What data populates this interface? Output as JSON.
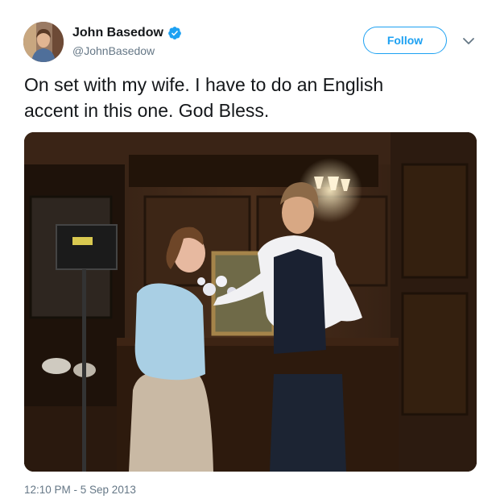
{
  "colors": {
    "brand_blue": "#1da1f2",
    "secondary_text": "#657786",
    "primary_text": "#14171a"
  },
  "author": {
    "display_name": "John Basedow",
    "handle": "@JohnBasedow",
    "verified": true,
    "avatar_icon": "avatar-photo"
  },
  "actions": {
    "follow_label": "Follow",
    "more_icon": "chevron-down-icon"
  },
  "tweet": {
    "text_line_1": "On set with my wife. I have to do an English",
    "text_line_2": "accent in this one. God Bless.",
    "timestamp": "12:10 PM - 5 Sep 2013"
  },
  "media": {
    "type": "photo"
  }
}
